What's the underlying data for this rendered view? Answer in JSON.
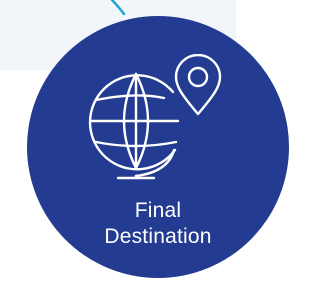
{
  "step": {
    "label_line1": "Final",
    "label_line2": "Destination",
    "icon": "globe-location-pin-icon"
  },
  "colors": {
    "circle_fill": "#233b91",
    "connector": "#16a7d8",
    "icon_stroke": "#ffffff",
    "text": "#ffffff",
    "background_panel": "#f2f5f9"
  }
}
